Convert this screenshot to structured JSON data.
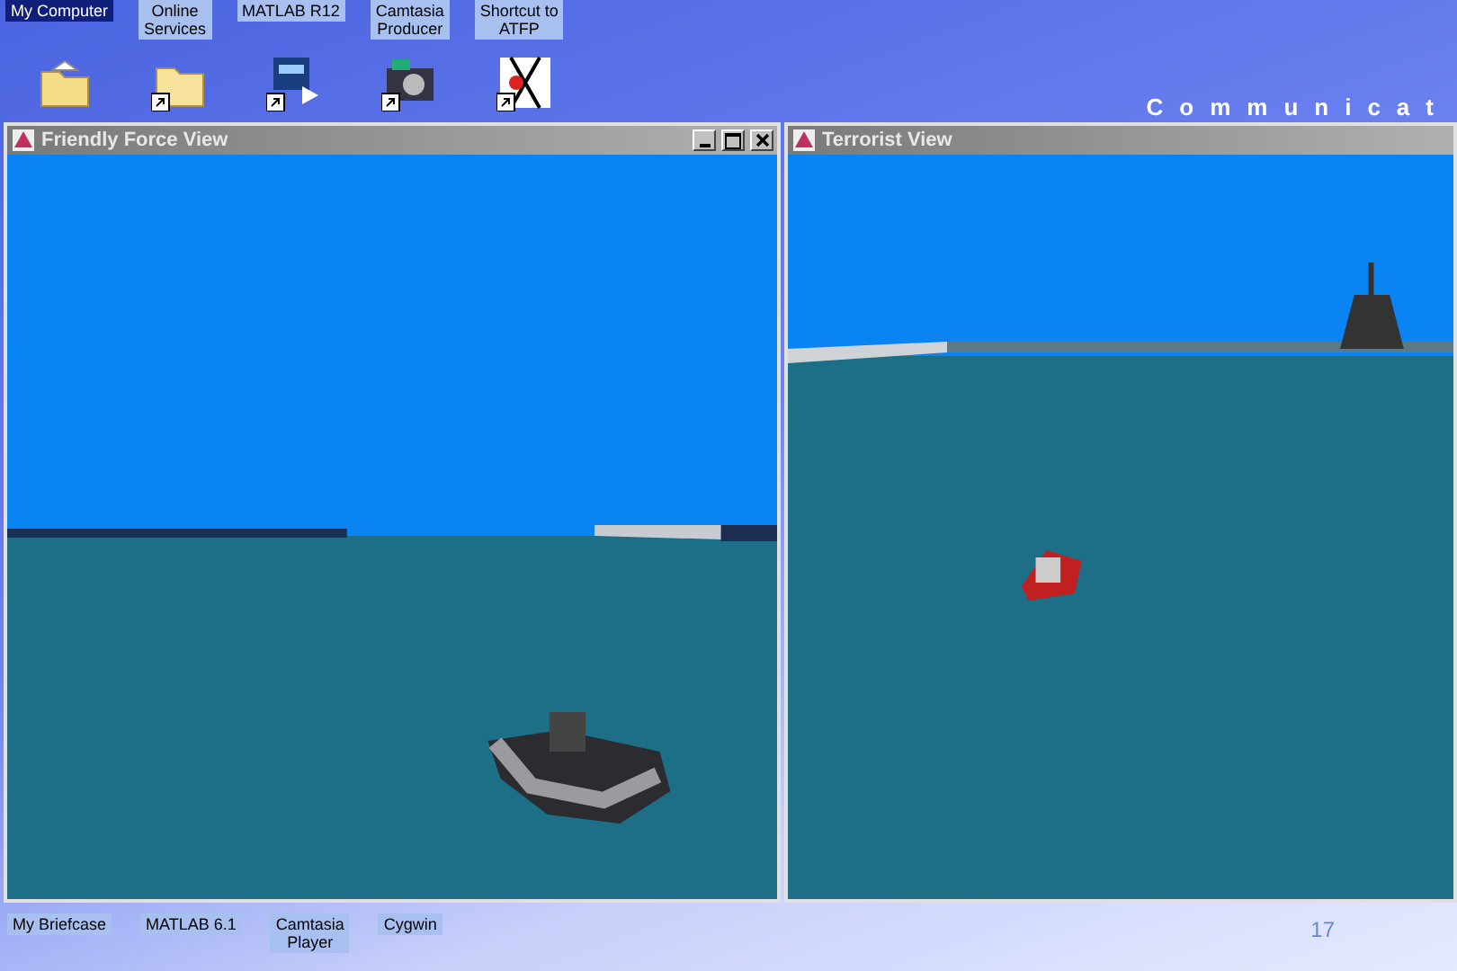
{
  "slide": {
    "brand": "Communicat",
    "number": "17"
  },
  "desktop_labels": [
    {
      "lines": [
        "My Computer"
      ],
      "selected": true
    },
    {
      "lines": [
        "Online",
        "Services"
      ],
      "selected": false
    },
    {
      "lines": [
        "MATLAB R12"
      ],
      "selected": false
    },
    {
      "lines": [
        "Camtasia",
        "Producer"
      ],
      "selected": false
    },
    {
      "lines": [
        "Shortcut to",
        "ATFP"
      ],
      "selected": false
    }
  ],
  "desktop_icons": [
    {
      "kind": "documents",
      "shortcut": false
    },
    {
      "kind": "folder",
      "shortcut": true
    },
    {
      "kind": "player",
      "shortcut": true
    },
    {
      "kind": "camera",
      "shortcut": true
    },
    {
      "kind": "tool3d",
      "shortcut": true
    }
  ],
  "windows": [
    {
      "title": "Friendly Force View",
      "controls": [
        {
          "kind": "minimize"
        },
        {
          "kind": "maximize"
        },
        {
          "kind": "close"
        }
      ],
      "kind": "friendly"
    },
    {
      "title": "Terrorist View",
      "kind": "terrorist"
    }
  ],
  "bottom_labels": [
    {
      "lines": [
        "My Briefcase"
      ]
    },
    {
      "lines": [
        "MATLAB 6.1"
      ]
    },
    {
      "lines": [
        "Camtasia",
        "Player"
      ]
    },
    {
      "lines": [
        "Cygwin"
      ]
    }
  ]
}
